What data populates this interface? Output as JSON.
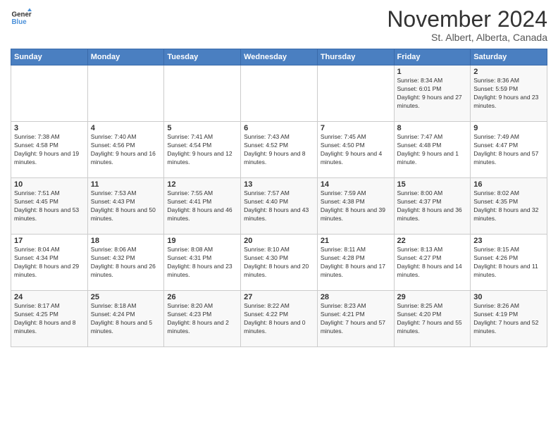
{
  "logo": {
    "line1": "General",
    "line2": "Blue"
  },
  "title": "November 2024",
  "subtitle": "St. Albert, Alberta, Canada",
  "days_of_week": [
    "Sunday",
    "Monday",
    "Tuesday",
    "Wednesday",
    "Thursday",
    "Friday",
    "Saturday"
  ],
  "weeks": [
    [
      {
        "day": "",
        "info": ""
      },
      {
        "day": "",
        "info": ""
      },
      {
        "day": "",
        "info": ""
      },
      {
        "day": "",
        "info": ""
      },
      {
        "day": "",
        "info": ""
      },
      {
        "day": "1",
        "info": "Sunrise: 8:34 AM\nSunset: 6:01 PM\nDaylight: 9 hours and 27 minutes."
      },
      {
        "day": "2",
        "info": "Sunrise: 8:36 AM\nSunset: 5:59 PM\nDaylight: 9 hours and 23 minutes."
      }
    ],
    [
      {
        "day": "3",
        "info": "Sunrise: 7:38 AM\nSunset: 4:58 PM\nDaylight: 9 hours and 19 minutes."
      },
      {
        "day": "4",
        "info": "Sunrise: 7:40 AM\nSunset: 4:56 PM\nDaylight: 9 hours and 16 minutes."
      },
      {
        "day": "5",
        "info": "Sunrise: 7:41 AM\nSunset: 4:54 PM\nDaylight: 9 hours and 12 minutes."
      },
      {
        "day": "6",
        "info": "Sunrise: 7:43 AM\nSunset: 4:52 PM\nDaylight: 9 hours and 8 minutes."
      },
      {
        "day": "7",
        "info": "Sunrise: 7:45 AM\nSunset: 4:50 PM\nDaylight: 9 hours and 4 minutes."
      },
      {
        "day": "8",
        "info": "Sunrise: 7:47 AM\nSunset: 4:48 PM\nDaylight: 9 hours and 1 minute."
      },
      {
        "day": "9",
        "info": "Sunrise: 7:49 AM\nSunset: 4:47 PM\nDaylight: 8 hours and 57 minutes."
      }
    ],
    [
      {
        "day": "10",
        "info": "Sunrise: 7:51 AM\nSunset: 4:45 PM\nDaylight: 8 hours and 53 minutes."
      },
      {
        "day": "11",
        "info": "Sunrise: 7:53 AM\nSunset: 4:43 PM\nDaylight: 8 hours and 50 minutes."
      },
      {
        "day": "12",
        "info": "Sunrise: 7:55 AM\nSunset: 4:41 PM\nDaylight: 8 hours and 46 minutes."
      },
      {
        "day": "13",
        "info": "Sunrise: 7:57 AM\nSunset: 4:40 PM\nDaylight: 8 hours and 43 minutes."
      },
      {
        "day": "14",
        "info": "Sunrise: 7:59 AM\nSunset: 4:38 PM\nDaylight: 8 hours and 39 minutes."
      },
      {
        "day": "15",
        "info": "Sunrise: 8:00 AM\nSunset: 4:37 PM\nDaylight: 8 hours and 36 minutes."
      },
      {
        "day": "16",
        "info": "Sunrise: 8:02 AM\nSunset: 4:35 PM\nDaylight: 8 hours and 32 minutes."
      }
    ],
    [
      {
        "day": "17",
        "info": "Sunrise: 8:04 AM\nSunset: 4:34 PM\nDaylight: 8 hours and 29 minutes."
      },
      {
        "day": "18",
        "info": "Sunrise: 8:06 AM\nSunset: 4:32 PM\nDaylight: 8 hours and 26 minutes."
      },
      {
        "day": "19",
        "info": "Sunrise: 8:08 AM\nSunset: 4:31 PM\nDaylight: 8 hours and 23 minutes."
      },
      {
        "day": "20",
        "info": "Sunrise: 8:10 AM\nSunset: 4:30 PM\nDaylight: 8 hours and 20 minutes."
      },
      {
        "day": "21",
        "info": "Sunrise: 8:11 AM\nSunset: 4:28 PM\nDaylight: 8 hours and 17 minutes."
      },
      {
        "day": "22",
        "info": "Sunrise: 8:13 AM\nSunset: 4:27 PM\nDaylight: 8 hours and 14 minutes."
      },
      {
        "day": "23",
        "info": "Sunrise: 8:15 AM\nSunset: 4:26 PM\nDaylight: 8 hours and 11 minutes."
      }
    ],
    [
      {
        "day": "24",
        "info": "Sunrise: 8:17 AM\nSunset: 4:25 PM\nDaylight: 8 hours and 8 minutes."
      },
      {
        "day": "25",
        "info": "Sunrise: 8:18 AM\nSunset: 4:24 PM\nDaylight: 8 hours and 5 minutes."
      },
      {
        "day": "26",
        "info": "Sunrise: 8:20 AM\nSunset: 4:23 PM\nDaylight: 8 hours and 2 minutes."
      },
      {
        "day": "27",
        "info": "Sunrise: 8:22 AM\nSunset: 4:22 PM\nDaylight: 8 hours and 0 minutes."
      },
      {
        "day": "28",
        "info": "Sunrise: 8:23 AM\nSunset: 4:21 PM\nDaylight: 7 hours and 57 minutes."
      },
      {
        "day": "29",
        "info": "Sunrise: 8:25 AM\nSunset: 4:20 PM\nDaylight: 7 hours and 55 minutes."
      },
      {
        "day": "30",
        "info": "Sunrise: 8:26 AM\nSunset: 4:19 PM\nDaylight: 7 hours and 52 minutes."
      }
    ]
  ]
}
